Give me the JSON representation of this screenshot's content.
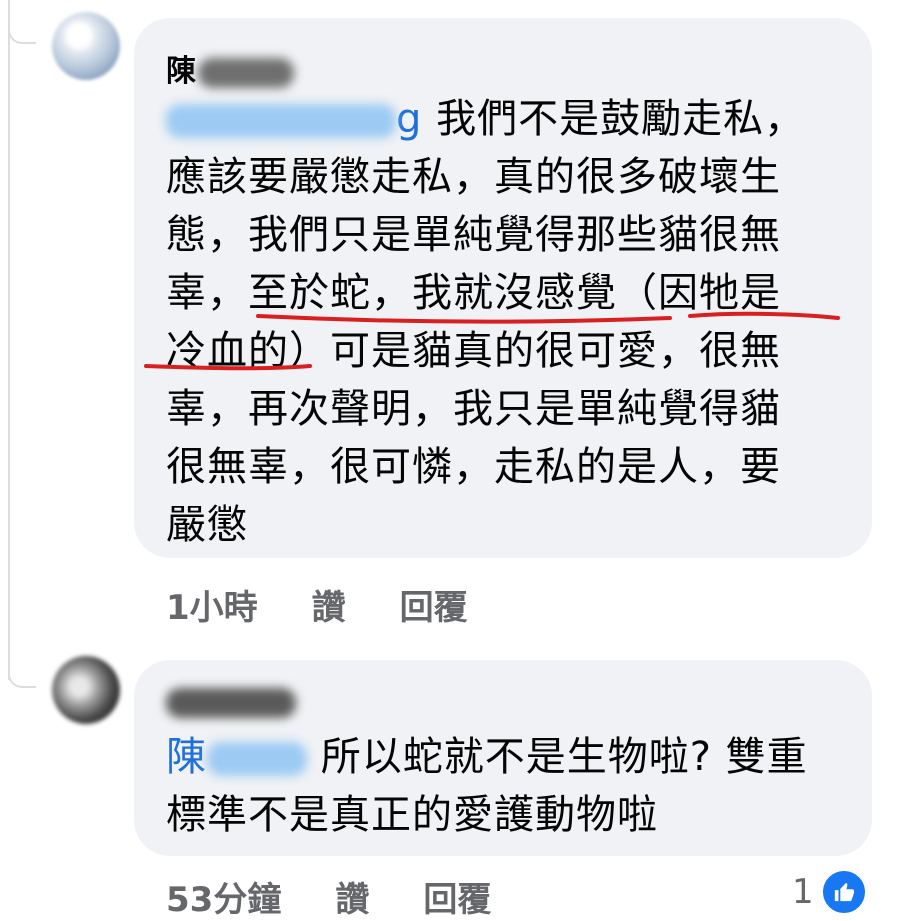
{
  "comments": [
    {
      "author": "陳",
      "mention": "g",
      "lines": [
        "我們不是鼓勵走私，",
        "應該要嚴懲走私，真的很多破壞生",
        "態，我們只是單純覺得那些貓很無",
        "辜，至於蛇，我就沒感覺（因牠是",
        "冷血的）可是貓真的很可愛，很無",
        "辜，再次聲明，我只是單純覺得貓",
        "很無辜，很可憐，走私的是人，要",
        "嚴懲"
      ],
      "time": "1小時",
      "like_label": "讚",
      "reply_label": "回覆"
    },
    {
      "author": "",
      "mention": "陳",
      "lines": [
        "所以蛇就不是生物啦? 雙重",
        "標準不是真正的愛護動物啦"
      ],
      "time": "53分鐘",
      "like_label": "讚",
      "reply_label": "回覆",
      "reaction_count": "1"
    }
  ],
  "colors": {
    "bubble": "#f0f2f5",
    "mention": "#216fdb",
    "meta": "#65676b",
    "annotation": "#d92020",
    "like": "#1877f2"
  },
  "icons": {
    "reaction": "thumbs-up-icon"
  }
}
